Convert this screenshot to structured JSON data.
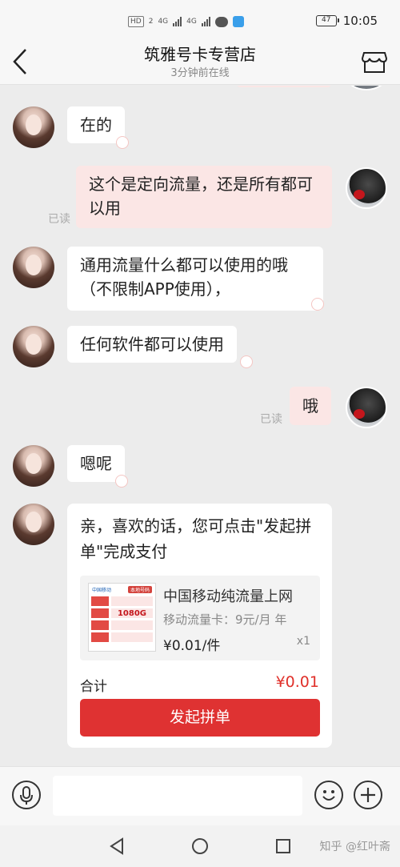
{
  "status_bar": {
    "hd_label": "HD",
    "sim1": "2",
    "net1": "4G",
    "net2": "4G",
    "battery": "47",
    "time": "10:05"
  },
  "header": {
    "title": "筑雅号卡专营店",
    "status": "3分钟前在线"
  },
  "messages": [
    {
      "side": "in",
      "text": "在的"
    },
    {
      "side": "out",
      "text": "这个是定向流量，还是所有都可以用",
      "read": "已读"
    },
    {
      "side": "in",
      "text": "通用流量什么都可以使用的哦（不限制APP使用），"
    },
    {
      "side": "in",
      "text": "任何软件都可以使用"
    },
    {
      "side": "out",
      "text": "哦",
      "read": "已读"
    },
    {
      "side": "in",
      "text": "嗯呢"
    }
  ],
  "order_card": {
    "message": "亲，喜欢的话，您可点击\"发起拼单\"完成支付",
    "thumb_brand": "中国移动",
    "thumb_tag": "本地号码",
    "thumb_big": "1080G",
    "product_name": "中国移动纯流量上网",
    "product_desc": "移动流量卡：9元/月 年",
    "price": "¥0.01/件",
    "qty": "x1",
    "total_label": "合计",
    "total_value": "¥0.01",
    "button_label": "发起拼单"
  },
  "input_bar": {
    "placeholder": ""
  },
  "watermark": "知乎 @红叶斋",
  "colors": {
    "accent_red": "#df3232",
    "out_bubble": "#fbe6e5",
    "background": "#ececec"
  }
}
